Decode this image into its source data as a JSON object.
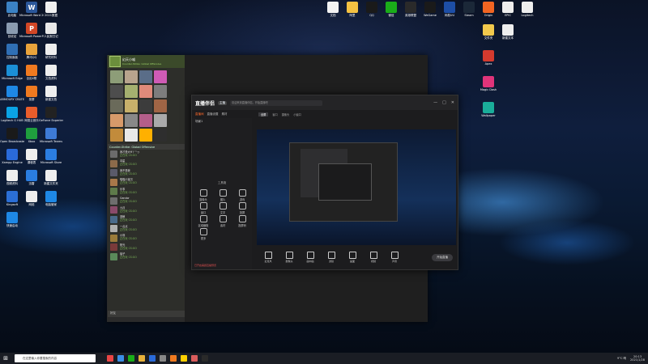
{
  "desktop": {
    "left_icons": [
      {
        "label": "此电脑",
        "color": "#3b82c4"
      },
      {
        "label": "Microsoft Word 2019",
        "color": "#2b579a",
        "glyph": "W"
      },
      {
        "label": "2021数据",
        "color": "#f0f0f0"
      },
      {
        "label": "回收站",
        "color": "#8a9bb0"
      },
      {
        "label": "Microsoft PowerPoint",
        "color": "#d24726",
        "glyph": "P"
      },
      {
        "label": "人民报日记",
        "color": "#e8e8e8"
      },
      {
        "label": "控制面板",
        "color": "#2f6fb5"
      },
      {
        "label": "腾讯QQ",
        "color": "#e9a33b"
      },
      {
        "label": "研究材料",
        "color": "#eeeeee"
      },
      {
        "label": "Microsoft Edge",
        "color": "#1b8fd6"
      },
      {
        "label": "全民K歌",
        "color": "#f07a20"
      },
      {
        "label": "文档资料",
        "color": "#eeeeee"
      },
      {
        "label": "ARMOURY CRATE",
        "color": "#1e88e5"
      },
      {
        "label": "录屏",
        "color": "#f07a20"
      },
      {
        "label": "新建文档",
        "color": "#eeeeee"
      },
      {
        "label": "Logitech G HUB",
        "color": "#0aa3e6"
      },
      {
        "label": "网易云音乐",
        "color": "#e95d2b"
      },
      {
        "label": "GeForce Experience",
        "color": "#222222"
      },
      {
        "label": "Open Broadcaster",
        "color": "#1a1a1a"
      },
      {
        "label": "Xbox",
        "color": "#1f9e3e"
      },
      {
        "label": "Microsoft Teams",
        "color": "#3e7bd6"
      },
      {
        "label": "Xampp Engine",
        "color": "#2a6ad9"
      },
      {
        "label": "课程表",
        "color": "#eeeeee"
      },
      {
        "label": "Microsoft Store",
        "color": "#2b7de0"
      },
      {
        "label": "视频资料",
        "color": "#eeeeee"
      },
      {
        "label": "迅雷",
        "color": "#2a7de0"
      },
      {
        "label": "新建文件夹",
        "color": "#eeeeee"
      },
      {
        "label": "Kingsoft",
        "color": "#2b6fd6"
      },
      {
        "label": "网络",
        "color": "#eeeeee"
      },
      {
        "label": "电脑管家",
        "color": "#1e88e5"
      },
      {
        "label": "快速启动",
        "color": "#1e88e5"
      }
    ],
    "right_icons": [
      {
        "label": "文档",
        "color": "#f2f2f2"
      },
      {
        "label": "阿里",
        "color": "#f5c242"
      },
      {
        "label": "QQ",
        "color": "#1a1a1a"
      },
      {
        "label": "微信",
        "color": "#1aad19"
      },
      {
        "label": "英雄联盟",
        "color": "#2a2a2a"
      },
      {
        "label": "WeGame",
        "color": "#1a1a1a"
      },
      {
        "label": "网易UU",
        "color": "#1d4ea6"
      },
      {
        "label": "Steam",
        "color": "#1b2838"
      },
      {
        "label": "Origin",
        "color": "#f26522"
      },
      {
        "label": "EPIC",
        "color": "#eeeeee"
      },
      {
        "label": "Logitech",
        "color": "#eeeeee"
      },
      {
        "label": "文件夹",
        "color": "#f2c94c"
      },
      {
        "label": "新建文本",
        "color": "#eeeeee"
      },
      {
        "label": "Apex",
        "color": "#d43a2e"
      },
      {
        "label": "Magic Dash",
        "color": "#e0347a"
      },
      {
        "label": "Wallpaper",
        "color": "#1aad9a"
      }
    ]
  },
  "friend_panel": {
    "title": "幻天小喵",
    "subtitle": "Counter-Strike: Global Offensive",
    "section_title": "Counter-Strike: Global Offensive",
    "grid_colors": [
      "#8d9d78",
      "#b8a48d",
      "#5a6d88",
      "#cf5bb5",
      "#4d4d4d",
      "#a5b06f",
      "#e08a7a",
      "#7d7d7d",
      "#6a6a5a",
      "#c7b06a",
      "#3c3c3c",
      "#a06545",
      "#d79a6a",
      "#888888",
      "#b45e8a",
      "#aaaaaa",
      "#c28b3b",
      "#e8e8e8",
      "#ffb000",
      "#2e2e2e"
    ],
    "friends": [
      {
        "name": "我才是大Ψ丫^ヮ",
        "status": "正在玩 CS:GO",
        "color": "#6b6b6b"
      },
      {
        "name": "毒星",
        "status": "正在玩 CS:GO",
        "color": "#8c6a4a"
      },
      {
        "name": "我不是我",
        "status": "正在玩 CS:GO",
        "color": "#5a5a6a"
      },
      {
        "name": "喵喵小宝贝",
        "status": "正在玩 CS:GO",
        "color": "#a8784a"
      },
      {
        "name": "乐事",
        "status": "正在玩 CS:GO",
        "color": "#5e7a4a"
      },
      {
        "name": "Gandor",
        "status": "正在玩 CS:GO",
        "color": "#6e6e6e"
      },
      {
        "name": "九月",
        "status": "正在玩 CS:GO",
        "color": "#8a4a6a"
      },
      {
        "name": "蓝鲸",
        "status": "正在玩 CS:GO",
        "color": "#4a6a8a"
      },
      {
        "name": "一点点",
        "status": "正在玩 CS:GO",
        "color": "#b0b0b0"
      },
      {
        "name": "小熊",
        "status": "正在玩 CS:GO",
        "color": "#9a7a3a"
      },
      {
        "name": "阳光",
        "status": "正在玩 CS:GO",
        "color": "#7a3a3a"
      },
      {
        "name": "柚子",
        "status": "正在玩 CS:GO",
        "color": "#5a8a5a"
      }
    ],
    "bottom_label": "好友"
  },
  "app": {
    "logo": "直播伴侣",
    "badge": "主播",
    "title_text": "欢迎来到直播伴侣，开始直播吧",
    "tabs": [
      "直播间",
      "直播设置",
      "素材"
    ],
    "left_header": "场景1",
    "tools_title": "工具箱",
    "tools": [
      "摄像头",
      "图片",
      "游戏",
      "窗口",
      "文字",
      "投屏",
      "区域截取",
      "素材",
      "投屏码",
      "更多"
    ],
    "right_tabs": [
      "全屏",
      "窗口",
      "摄像头",
      "小窗口"
    ],
    "controls": [
      "麦克风",
      "摄像头",
      "画中画",
      "滤镜",
      "画面",
      "视频",
      "声音"
    ],
    "go_live": "开始直播",
    "warning": "已开启美颜直播预览",
    "window_controls": [
      "—",
      "□",
      "✕"
    ]
  },
  "taskbar": {
    "search_placeholder": "在这里输入你要搜索的内容",
    "tray_weather": "9°C 晴",
    "time": "20:13",
    "date": "2021/1/28",
    "app_colors": [
      "#e94545",
      "#3a8ee6",
      "#1aad19",
      "#e8b13a",
      "#2a6ad9",
      "#888888",
      "#f07a20",
      "#ffd000",
      "#d95c5c",
      "#2a2a2a"
    ]
  }
}
